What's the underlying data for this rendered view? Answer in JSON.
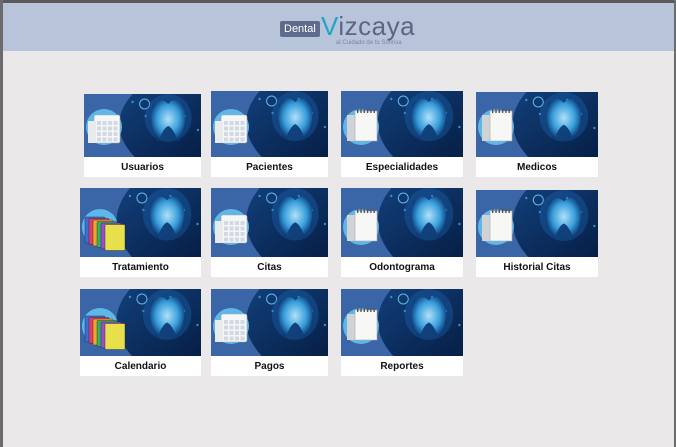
{
  "brand": {
    "left": "Dental",
    "right_initial": "V",
    "right_rest": "izcaya",
    "tagline": "al Cuidado de tu Sonrisa"
  },
  "colors": {
    "header": "#b7c4d9",
    "background": "#eae8e8",
    "tile_blue_dark": "#0d2e5c",
    "tile_blue": "#3e6cae"
  },
  "tiles": [
    {
      "label": "Usuarios",
      "icon": "clipboard-icon"
    },
    {
      "label": "Pacientes",
      "icon": "calendar-icon"
    },
    {
      "label": "Especialidades",
      "icon": "notepad-icon"
    },
    {
      "label": "Medicos",
      "icon": "notepad-icon"
    },
    {
      "label": "Tratamiento",
      "icon": "folders-icon"
    },
    {
      "label": "Citas",
      "icon": "calendar-icon"
    },
    {
      "label": "Odontograma",
      "icon": "notepad-icon"
    },
    {
      "label": "Historial Citas",
      "icon": "notepad-icon"
    },
    {
      "label": "Calendario",
      "icon": "folders-icon"
    },
    {
      "label": "Pagos",
      "icon": "calendar-icon"
    },
    {
      "label": "Reportes",
      "icon": "notepad-icon"
    }
  ]
}
